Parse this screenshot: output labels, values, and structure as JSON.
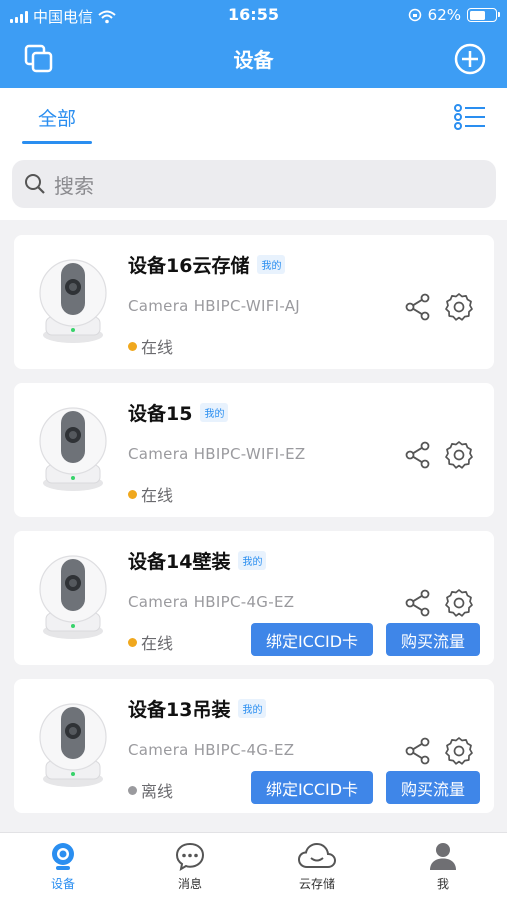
{
  "status_bar": {
    "carrier": "中国电信",
    "time": "16:55",
    "battery": "62%",
    "battery_level": 0.62
  },
  "nav": {
    "title": "设备",
    "left_icon": "multi-window-icon",
    "right_icon": "add-circle-icon"
  },
  "tabs": {
    "all_label": "全部",
    "list_icon": "list-view-icon"
  },
  "search": {
    "placeholder": "搜索"
  },
  "devices": [
    {
      "name": "设备16云存储",
      "tag": "我的",
      "model": "Camera  HBIPC-WIFI-AJ",
      "status": "在线",
      "status_color": "#f0a81e"
    },
    {
      "name": "设备15",
      "tag": "我的",
      "model": "Camera  HBIPC-WIFI-EZ",
      "status": "在线",
      "status_color": "#f0a81e"
    },
    {
      "name": "设备14壁装",
      "tag": "我的",
      "model": "Camera  HBIPC-4G-EZ",
      "status": "在线",
      "status_color": "#f0a81e",
      "btn_iccid": "绑定ICCID卡",
      "btn_flow": "购买流量"
    },
    {
      "name": "设备13吊装",
      "tag": "我的",
      "model": "Camera  HBIPC-4G-EZ",
      "status": "离线",
      "status_color": "#9a9a9e",
      "btn_iccid": "绑定ICCID卡",
      "btn_flow": "购买流量"
    }
  ],
  "tabbar": [
    {
      "label": "设备",
      "icon": "camera-icon",
      "active": true
    },
    {
      "label": "消息",
      "icon": "message-bubble-icon",
      "active": false
    },
    {
      "label": "云存储",
      "icon": "cloud-icon",
      "active": false
    },
    {
      "label": "我",
      "icon": "person-icon",
      "active": false
    }
  ],
  "colors": {
    "primary": "#3d9df4",
    "accent": "#2a8ef0",
    "button": "#3f86e8",
    "online": "#f0a81e",
    "offline": "#9a9a9e"
  }
}
